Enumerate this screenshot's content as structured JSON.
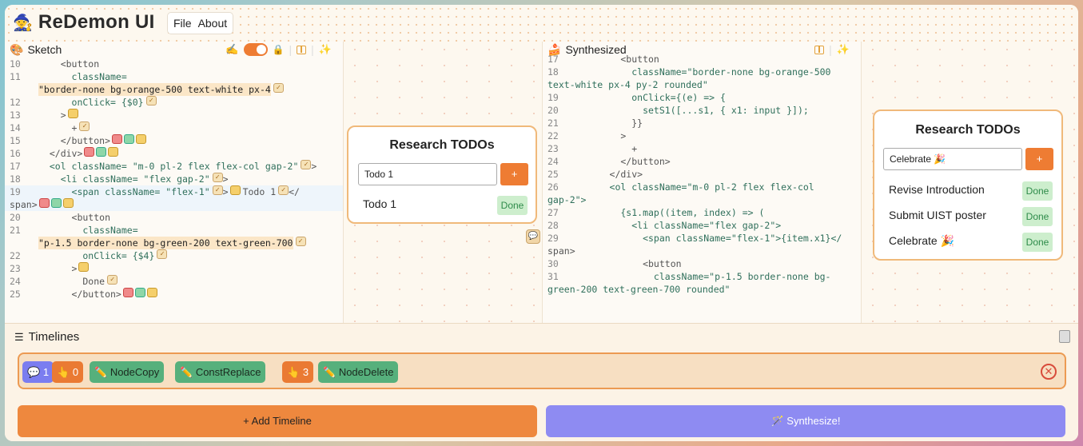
{
  "app": {
    "title": "ReDemon UI",
    "logo_icon": "🧙"
  },
  "menu": {
    "file": "File",
    "about": "About"
  },
  "sketch": {
    "header": "Sketch",
    "lines": [
      {
        "n": "10",
        "t": "    <button"
      },
      {
        "n": "11",
        "t": "      className="
      },
      {
        "n": "",
        "t": "\"border-none bg-orange-500 text-white px-4"
      },
      {
        "n": "12",
        "t": "      onClick= {$0}"
      },
      {
        "n": "13",
        "t": "    >"
      },
      {
        "n": "14",
        "t": "      +"
      },
      {
        "n": "15",
        "t": "    </button>"
      },
      {
        "n": "16",
        "t": "  </div>"
      },
      {
        "n": "17",
        "t": "  <ol className= \"m-0 pl-2 flex flex-col gap-2\""
      },
      {
        "n": "18",
        "t": "    <li className= \"flex gap-2\""
      },
      {
        "n": "19",
        "t": "      <span className= \"flex-1\""
      },
      {
        "n": "",
        "t": "span>"
      },
      {
        "n": "20",
        "t": "      <button"
      },
      {
        "n": "21",
        "t": "        className="
      },
      {
        "n": "",
        "t": "\"p-1.5 border-none bg-green-200 text-green-700"
      },
      {
        "n": "22",
        "t": "        onClick= {$4}"
      },
      {
        "n": "23",
        "t": "      >"
      },
      {
        "n": "24",
        "t": "        Done"
      },
      {
        "n": "25",
        "t": "      </button>"
      }
    ],
    "todo_inline": "Todo 1",
    "close_tag": "</"
  },
  "sketch_preview": {
    "title": "Research TODOs",
    "input_value": "Todo 1",
    "add_label": "+",
    "items": [
      {
        "label": "Todo 1",
        "done": "Done"
      }
    ]
  },
  "synthesized": {
    "header": "Synthesized",
    "lines": [
      {
        "n": "17",
        "t": "        <button"
      },
      {
        "n": "18",
        "t": "          className=\"border-none bg-orange-500"
      },
      {
        "n": "",
        "t": "text-white px-4 py-2 rounded\""
      },
      {
        "n": "19",
        "t": "          onClick={(e) => {"
      },
      {
        "n": "20",
        "t": "            setS1([...s1, { x1: input }]);"
      },
      {
        "n": "21",
        "t": "          }}"
      },
      {
        "n": "22",
        "t": "        >"
      },
      {
        "n": "23",
        "t": "          +"
      },
      {
        "n": "24",
        "t": "        </button>"
      },
      {
        "n": "25",
        "t": "      </div>"
      },
      {
        "n": "26",
        "t": "      <ol className=\"m-0 pl-2 flex flex-col"
      },
      {
        "n": "",
        "t": "gap-2\">"
      },
      {
        "n": "27",
        "t": "        {s1.map((item, index) => ("
      },
      {
        "n": "28",
        "t": "          <li className=\"flex gap-2\">"
      },
      {
        "n": "29",
        "t": "            <span className=\"flex-1\">{item.x1}</"
      },
      {
        "n": "",
        "t": "span>"
      },
      {
        "n": "30",
        "t": "            <button"
      },
      {
        "n": "31",
        "t": "              className=\"p-1.5 border-none bg-"
      },
      {
        "n": "",
        "t": "green-200 text-green-700 rounded\""
      }
    ]
  },
  "synth_preview": {
    "title": "Research TODOs",
    "input_value": "Celebrate 🎉",
    "add_label": "+",
    "items": [
      {
        "label": "Revise Introduction",
        "done": "Done"
      },
      {
        "label": "Submit UIST poster",
        "done": "Done"
      },
      {
        "label": "Celebrate 🎉",
        "done": "Done"
      }
    ]
  },
  "timelines": {
    "header": "Timelines",
    "tokens": [
      {
        "label": "1",
        "color": "blue",
        "icon": "💬"
      },
      {
        "label": "0",
        "color": "orange",
        "icon": "👆"
      },
      {
        "label": "NodeCopy",
        "color": "green",
        "icon": "✏️"
      },
      {
        "label": "ConstReplace",
        "color": "green",
        "icon": "✏️"
      },
      {
        "label": "3",
        "color": "orange",
        "icon": "👆"
      },
      {
        "label": "NodeDelete",
        "color": "green",
        "icon": "✏️"
      }
    ],
    "add_button": "+ Add Timeline",
    "synth_button": "🪄 Synthesize!"
  },
  "colors": {
    "accent": "#ee883e",
    "synth": "#8e8bf2",
    "done_bg": "#cdeecd"
  }
}
